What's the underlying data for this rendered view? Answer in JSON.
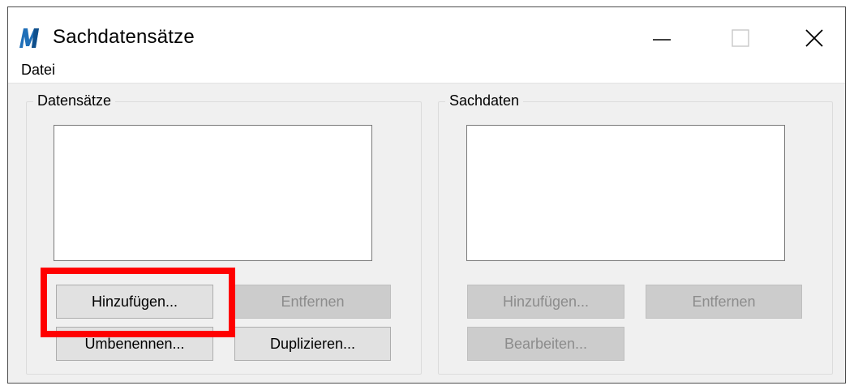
{
  "window": {
    "title": "Sachdatensätze",
    "icon": "microstation-logo-icon",
    "controls": {
      "minimize_glyph": "—",
      "maximize_glyph": "☐",
      "close_glyph": "✕"
    }
  },
  "menu": {
    "items": [
      {
        "label": "Datei",
        "mnemonic": "D"
      }
    ]
  },
  "datensaetze": {
    "legend": "Datensätze",
    "list_items": [],
    "buttons": {
      "add": "Hinzufügen...",
      "remove": "Entfernen",
      "rename": "Umbenennen...",
      "duplicate": "Duplizieren..."
    }
  },
  "sachdaten": {
    "legend": "Sachdaten",
    "list_items": [],
    "buttons": {
      "add": "Hinzufügen...",
      "remove": "Entfernen",
      "edit": "Bearbeiten..."
    }
  },
  "colors": {
    "highlight": "#ff0000",
    "icon_blue": "#1f6fb8",
    "disabled_text": "#8c8c8c"
  }
}
